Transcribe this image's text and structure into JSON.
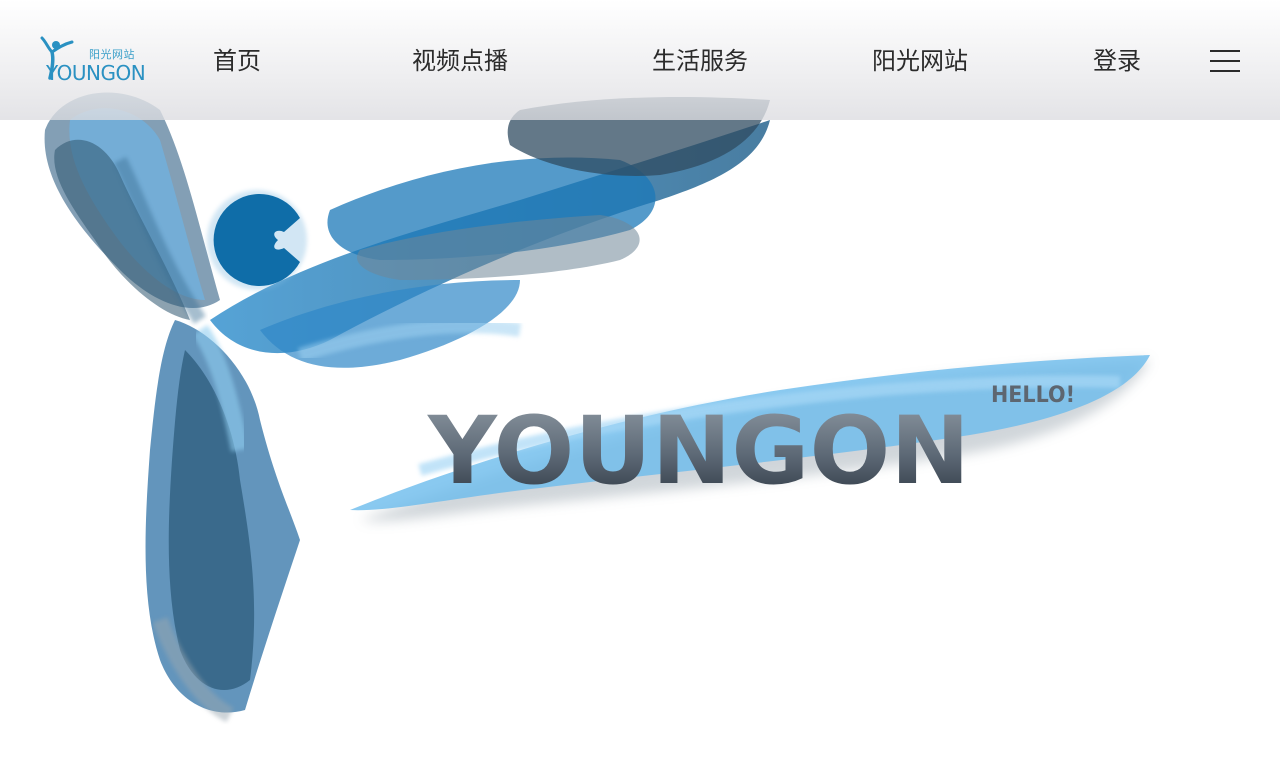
{
  "header": {
    "logo": {
      "sub_text": "阳光网站",
      "word_text": "YOUNGON"
    },
    "nav": [
      {
        "label": "首页"
      },
      {
        "label": "视频点播"
      },
      {
        "label": "生活服务"
      },
      {
        "label": "阳光网站"
      },
      {
        "label": "登录"
      }
    ],
    "menu_icon": "hamburger-menu-icon"
  },
  "hero": {
    "title": "YOUNGON",
    "greeting": "HELLO!"
  },
  "colors": {
    "brand_blue": "#1a79b8",
    "light_blue": "#74bde9",
    "dark_slate": "#2f3f4d",
    "text": "#2b2b2b"
  }
}
